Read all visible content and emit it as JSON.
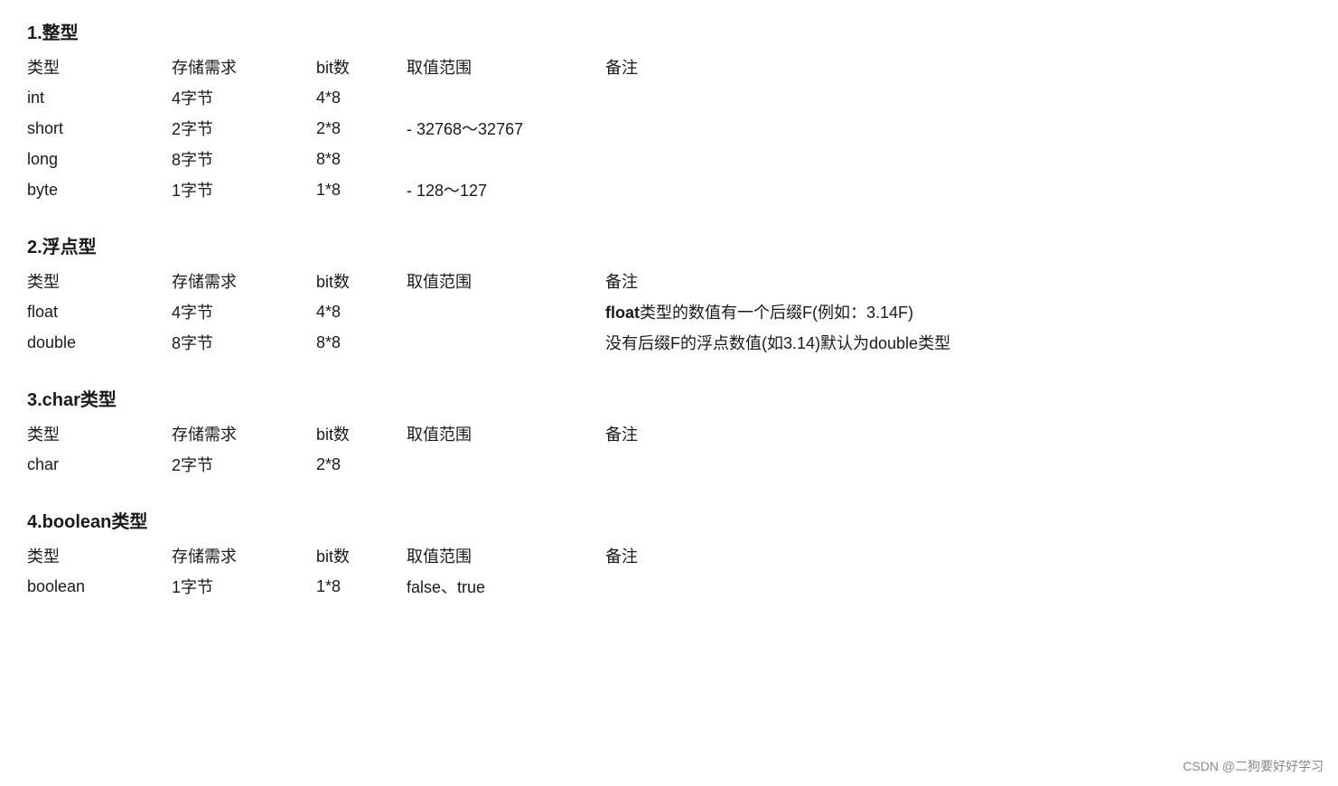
{
  "sections": [
    {
      "id": "integer",
      "title": "1.整型",
      "headers": [
        "类型",
        "存储需求",
        "bit数",
        "取值范围",
        "备注"
      ],
      "rows": [
        {
          "type": "int",
          "storage": "4字节",
          "bits": "4*8",
          "range": "",
          "notes": ""
        },
        {
          "type": "short",
          "storage": "2字节",
          "bits": "2*8",
          "range": "- 32768～32767",
          "notes": ""
        },
        {
          "type": "long",
          "storage": "8字节",
          "bits": "8*8",
          "range": "",
          "notes": ""
        },
        {
          "type": "byte",
          "storage": "1字节",
          "bits": "1*8",
          "range": "- 128～127",
          "notes": ""
        }
      ]
    },
    {
      "id": "float",
      "title": "2.浮点型",
      "headers": [
        "类型",
        "存储需求",
        "bit数",
        "取值范围",
        "备注"
      ],
      "rows": [
        {
          "type": "float",
          "storage": "4字节",
          "bits": "4*8",
          "range": "",
          "notes": "float类型的数值有一个后缀F(例如：3.14F)"
        },
        {
          "type": "double",
          "storage": "8字节",
          "bits": "8*8",
          "range": "",
          "notes": "没有后缀F的浮点数值(如3.14)默认为double类型"
        }
      ]
    },
    {
      "id": "char",
      "title": "3.char类型",
      "headers": [
        "类型",
        "存储需求",
        "bit数",
        "取值范围",
        "备注"
      ],
      "rows": [
        {
          "type": "char",
          "storage": "2字节",
          "bits": "2*8",
          "range": "",
          "notes": ""
        }
      ]
    },
    {
      "id": "boolean",
      "title": "4.boolean类型",
      "headers": [
        "类型",
        "存储需求",
        "bit数",
        "取值范围",
        "备注"
      ],
      "rows": [
        {
          "type": "boolean",
          "storage": "1字节",
          "bits": "1*8",
          "range": "false、true",
          "notes": ""
        }
      ]
    }
  ],
  "watermark": "CSDN @二狗要好好学习"
}
